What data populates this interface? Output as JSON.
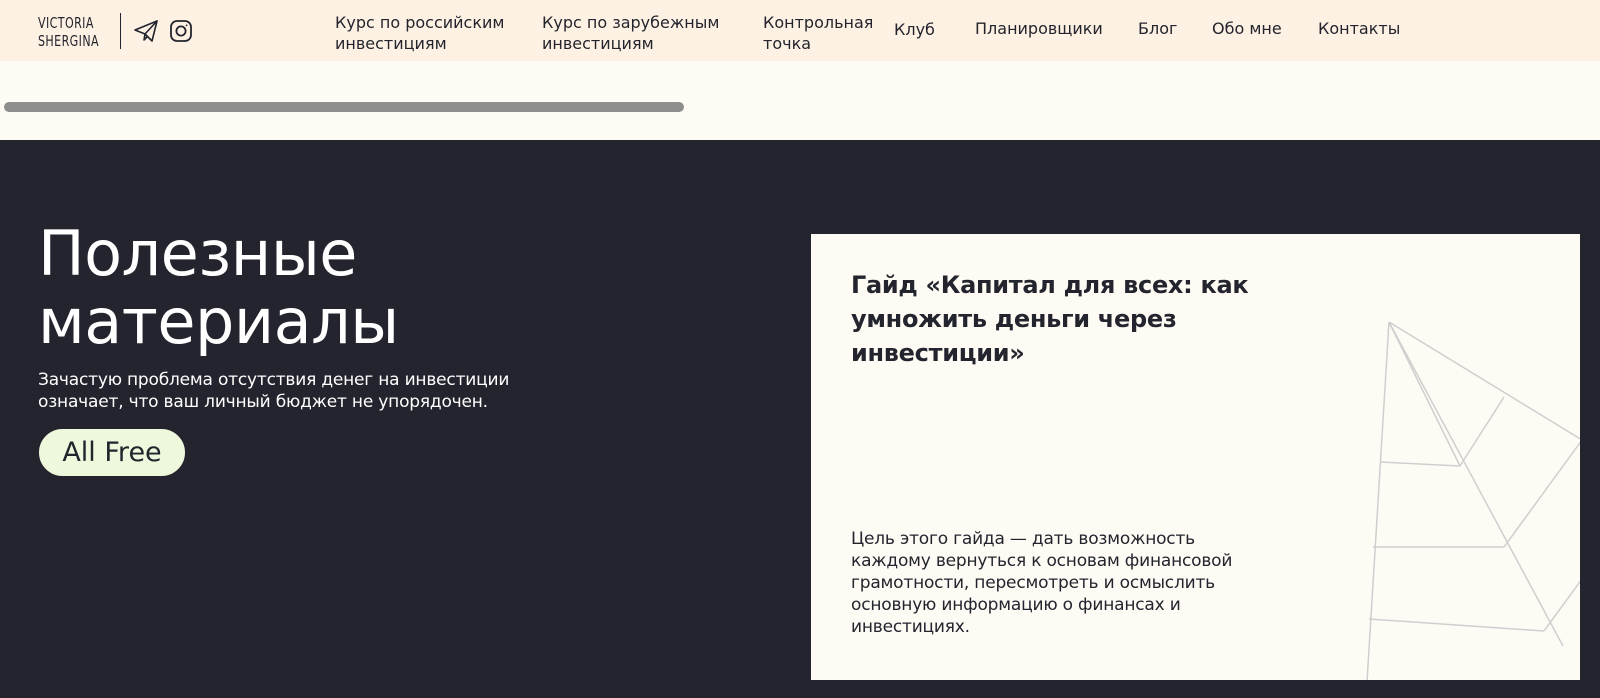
{
  "header": {
    "logo_line1": "VICTORIA",
    "logo_line2": "SHERGINA",
    "social": [
      "telegram-icon",
      "instagram-icon"
    ],
    "nav": [
      {
        "label": "Курс по российским инвестициям"
      },
      {
        "label": "Курс по зарубежным инвестициям"
      },
      {
        "label": "Контрольная точка"
      },
      {
        "label": "Клуб"
      },
      {
        "label": "Планировщики"
      },
      {
        "label": "Блог"
      },
      {
        "label": "Обо мне"
      },
      {
        "label": "Контакты"
      }
    ]
  },
  "hero": {
    "title": "Полезные материалы",
    "subtitle": "Зачастую проблема отсутствия денег на инвестиции означает, что ваш личный бюджет не упорядочен.",
    "button_label": "All Free"
  },
  "card": {
    "title": "Гайд «Капитал для всех: как умножить деньги через инвестиции»",
    "description": "Цель этого гайда — дать возможность каждому вернуться к основам финансовой грамотности, пересмотреть и осмыслить основную информацию о финансах и инвестициях."
  },
  "colors": {
    "header_bg": "#fdf1e3",
    "dark_bg": "#23242d",
    "card_bg": "#fefbf5",
    "button_bg": "#eef8dc",
    "scrollbar": "#8e8e8e",
    "leaf_lines": "#cfcfcf"
  }
}
